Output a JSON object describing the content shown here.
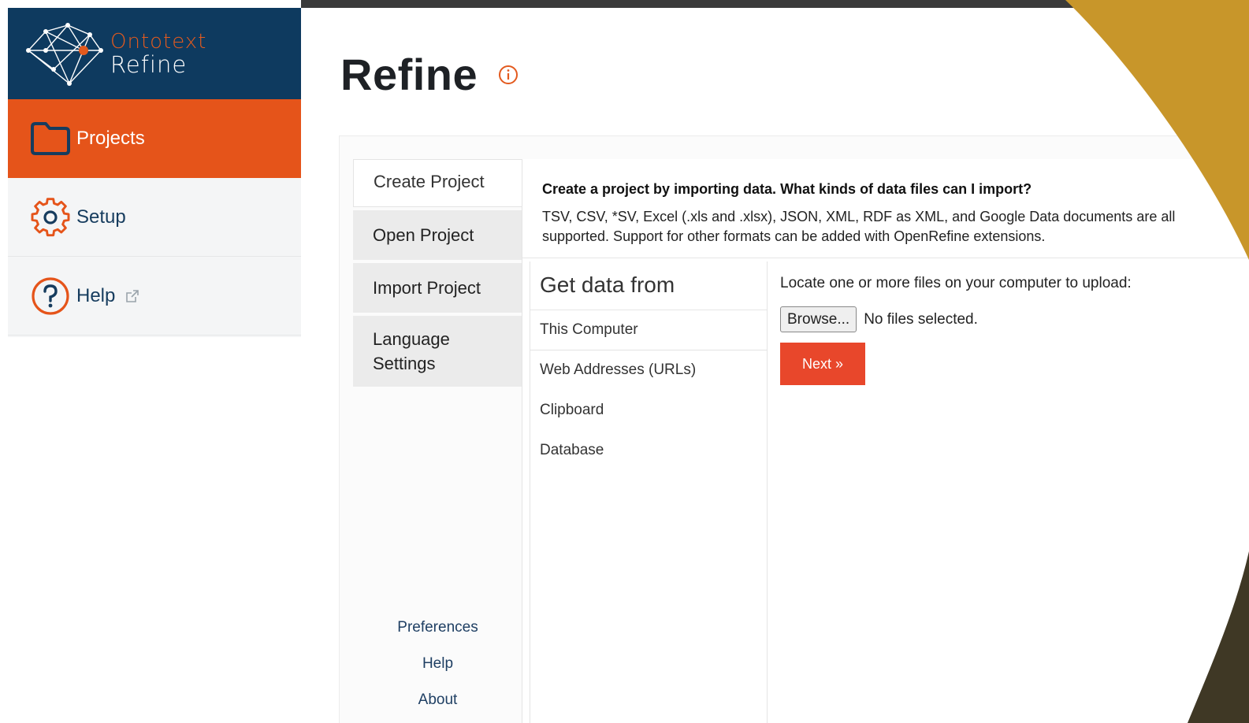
{
  "app": {
    "brand": "Ontotext",
    "product": "Refine"
  },
  "sidebar": {
    "items": [
      {
        "label": "Projects",
        "icon": "folder-icon"
      },
      {
        "label": "Setup",
        "icon": "gear-icon"
      },
      {
        "label": "Help",
        "icon": "question-icon"
      }
    ]
  },
  "header": {
    "title": "Refine"
  },
  "tabs": [
    {
      "label": "Create Project"
    },
    {
      "label": "Open Project"
    },
    {
      "label": "Import Project"
    },
    {
      "label": "Language Settings"
    }
  ],
  "footer_links": [
    "Preferences",
    "Help",
    "About"
  ],
  "intro": {
    "heading": "Create a project by importing data. What kinds of data files can I import?",
    "text": "TSV, CSV, *SV, Excel (.xls and .xlsx), JSON, XML, RDF as XML, and Google Data documents are all supported. Support for other formats can be added with OpenRefine extensions."
  },
  "sources": {
    "heading": "Get data from",
    "items": [
      "This Computer",
      "Web Addresses (URLs)",
      "Clipboard",
      "Database"
    ]
  },
  "upload": {
    "label": "Locate one or more files on your computer to upload:",
    "browse_label": "Browse...",
    "file_status": "No files selected.",
    "next_label": "Next »"
  },
  "colors": {
    "brand_navy": "#0e3a5f",
    "brand_orange": "#e5541a",
    "next_button": "#e8472b",
    "decoration_gold": "#c8962a",
    "decoration_dark": "#3f3825"
  }
}
